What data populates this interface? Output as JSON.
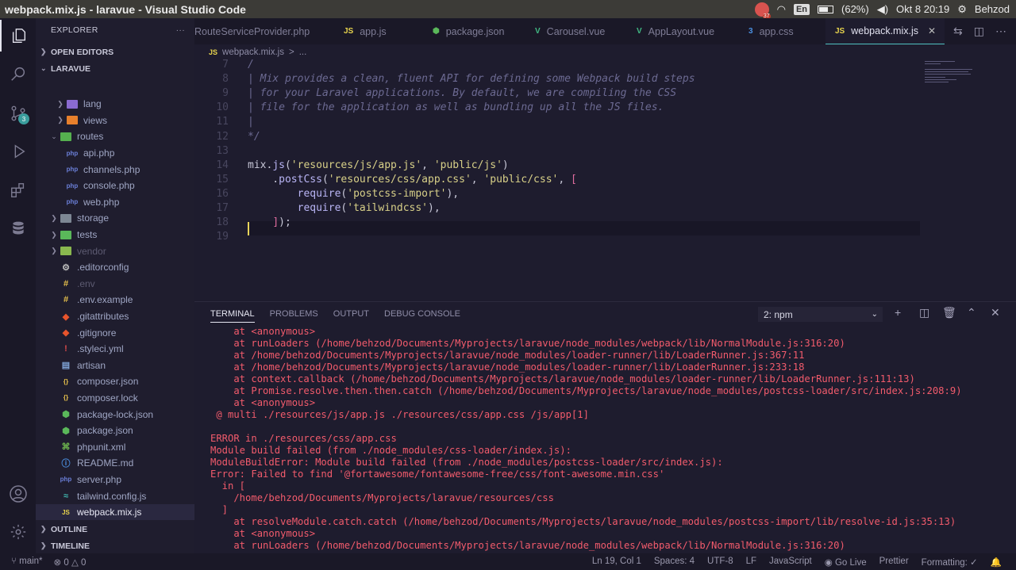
{
  "window": {
    "title": "webpack.mix.js - laravue - Visual Studio Code"
  },
  "system_tray": {
    "badge_count": "37",
    "keyboard_layout": "En",
    "battery": "(62%)",
    "datetime": "Okt  8 20:19",
    "user": "Behzod"
  },
  "activity_bar": {
    "source_control_badge": "3"
  },
  "sidebar": {
    "header": "EXPLORER",
    "header_more": "···",
    "open_editors": "OPEN EDITORS",
    "project": "LARAVUE",
    "outline": "OUTLINE",
    "timeline": "TIMELINE",
    "items": [
      {
        "label": "lang",
        "kind": "folder",
        "level": 2,
        "color": "#8b6bd1"
      },
      {
        "label": "views",
        "kind": "folder",
        "level": 2,
        "color": "#e8802c"
      },
      {
        "label": "routes",
        "kind": "folder-open",
        "level": 1,
        "color": "#55b04f"
      },
      {
        "label": "api.php",
        "kind": "php",
        "level": 2
      },
      {
        "label": "channels.php",
        "kind": "php",
        "level": 2
      },
      {
        "label": "console.php",
        "kind": "php",
        "level": 2
      },
      {
        "label": "web.php",
        "kind": "php",
        "level": 2
      },
      {
        "label": "storage",
        "kind": "folder",
        "level": 1,
        "color": "#7d8794"
      },
      {
        "label": "tests",
        "kind": "folder",
        "level": 1,
        "color": "#5ab85a"
      },
      {
        "label": "vendor",
        "kind": "folder",
        "level": 1,
        "color": "#8ab84f"
      },
      {
        "label": ".editorconfig",
        "kind": "config",
        "level": 1
      },
      {
        "label": ".env",
        "kind": "env",
        "level": 1
      },
      {
        "label": ".env.example",
        "kind": "env",
        "level": 1
      },
      {
        "label": ".gitattributes",
        "kind": "git",
        "level": 1
      },
      {
        "label": ".gitignore",
        "kind": "git",
        "level": 1
      },
      {
        "label": ".styleci.yml",
        "kind": "yml",
        "level": 1
      },
      {
        "label": "artisan",
        "kind": "file",
        "level": 1
      },
      {
        "label": "composer.json",
        "kind": "json",
        "level": 1
      },
      {
        "label": "composer.lock",
        "kind": "json",
        "level": 1
      },
      {
        "label": "package-lock.json",
        "kind": "npm",
        "level": 1
      },
      {
        "label": "package.json",
        "kind": "npm",
        "level": 1
      },
      {
        "label": "phpunit.xml",
        "kind": "xml",
        "level": 1
      },
      {
        "label": "README.md",
        "kind": "md",
        "level": 1
      },
      {
        "label": "server.php",
        "kind": "php",
        "level": 1
      },
      {
        "label": "tailwind.config.js",
        "kind": "tailwind",
        "level": 1
      },
      {
        "label": "webpack.mix.js",
        "kind": "js",
        "level": 1
      }
    ]
  },
  "tabs": [
    {
      "label": "RouteServiceProvider.php",
      "icon": "",
      "icon_color": "#7f7d96",
      "active": false
    },
    {
      "label": "app.js",
      "icon": "JS",
      "icon_color": "#e8d44d",
      "active": false
    },
    {
      "label": "package.json",
      "icon": "⬢",
      "icon_color": "#5ab85a",
      "active": false
    },
    {
      "label": "Carousel.vue",
      "icon": "V",
      "icon_color": "#41b883",
      "active": false
    },
    {
      "label": "AppLayout.vue",
      "icon": "V",
      "icon_color": "#41b883",
      "active": false
    },
    {
      "label": "app.css",
      "icon": "3",
      "icon_color": "#4a8fe0",
      "active": false
    },
    {
      "label": "webpack.mix.js",
      "icon": "JS",
      "icon_color": "#e8d44d",
      "active": true
    }
  ],
  "breadcrumb": {
    "file": "webpack.mix.js",
    "sep": ">",
    "more": "..."
  },
  "editor": {
    "lines": [
      {
        "n": "7",
        "t": "/",
        "c": "cmt"
      },
      {
        "n": "8",
        "t": "| Mix provides a clean, fluent API for defining some Webpack build steps",
        "c": "cmt"
      },
      {
        "n": "9",
        "t": "| for your Laravel applications. By default, we are compiling the CSS",
        "c": "cmt"
      },
      {
        "n": "10",
        "t": "| file for the application as well as bundling up all the JS files.",
        "c": "cmt"
      },
      {
        "n": "11",
        "t": "|",
        "c": "cmt"
      },
      {
        "n": "12",
        "t": "*/",
        "c": "cmt"
      },
      {
        "n": "13",
        "t": "",
        "c": "pun"
      },
      {
        "n": "14",
        "t": "mix.js('resources/js/app.js', 'public/js')",
        "c": "code"
      },
      {
        "n": "15",
        "t": "    .postCss('resources/css/app.css', 'public/css', [",
        "c": "code"
      },
      {
        "n": "16",
        "t": "        require('postcss-import'),",
        "c": "code"
      },
      {
        "n": "17",
        "t": "        require('tailwindcss'),",
        "c": "code"
      },
      {
        "n": "18",
        "t": "    ]);",
        "c": "code"
      },
      {
        "n": "19",
        "t": "",
        "c": "pun"
      }
    ]
  },
  "panel": {
    "tabs": [
      "TERMINAL",
      "PROBLEMS",
      "OUTPUT",
      "DEBUG CONSOLE"
    ],
    "terminal_select": "2: npm",
    "terminal_lines": [
      "    at <anonymous>",
      "    at runLoaders (/home/behzod/Documents/Myprojects/laravue/node_modules/webpack/lib/NormalModule.js:316:20)",
      "    at /home/behzod/Documents/Myprojects/laravue/node_modules/loader-runner/lib/LoaderRunner.js:367:11",
      "    at /home/behzod/Documents/Myprojects/laravue/node_modules/loader-runner/lib/LoaderRunner.js:233:18",
      "    at context.callback (/home/behzod/Documents/Myprojects/laravue/node_modules/loader-runner/lib/LoaderRunner.js:111:13)",
      "    at Promise.resolve.then.then.catch (/home/behzod/Documents/Myprojects/laravue/node_modules/postcss-loader/src/index.js:208:9)",
      "    at <anonymous>",
      " @ multi ./resources/js/app.js ./resources/css/app.css /js/app[1]",
      "",
      "ERROR in ./resources/css/app.css",
      "Module build failed (from ./node_modules/css-loader/index.js):",
      "ModuleBuildError: Module build failed (from ./node_modules/postcss-loader/src/index.js):",
      "Error: Failed to find '@fortawesome/fontawesome-free/css/font-awesome.min.css'",
      "  in [",
      "    /home/behzod/Documents/Myprojects/laravue/resources/css",
      "  ]",
      "    at resolveModule.catch.catch (/home/behzod/Documents/Myprojects/laravue/node_modules/postcss-import/lib/resolve-id.js:35:13)",
      "    at <anonymous>",
      "    at runLoaders (/home/behzod/Documents/Myprojects/laravue/node_modules/webpack/lib/NormalModule.js:316:20)"
    ]
  },
  "status_bar": {
    "branch": "main*",
    "errors": "0",
    "warnings": "0",
    "position": "Ln 19, Col 1",
    "spaces": "Spaces: 4",
    "encoding": "UTF-8",
    "eol": "LF",
    "language": "JavaScript",
    "golive": "Go Live",
    "prettier": "Prettier",
    "formatting": "Formatting: ✓"
  }
}
